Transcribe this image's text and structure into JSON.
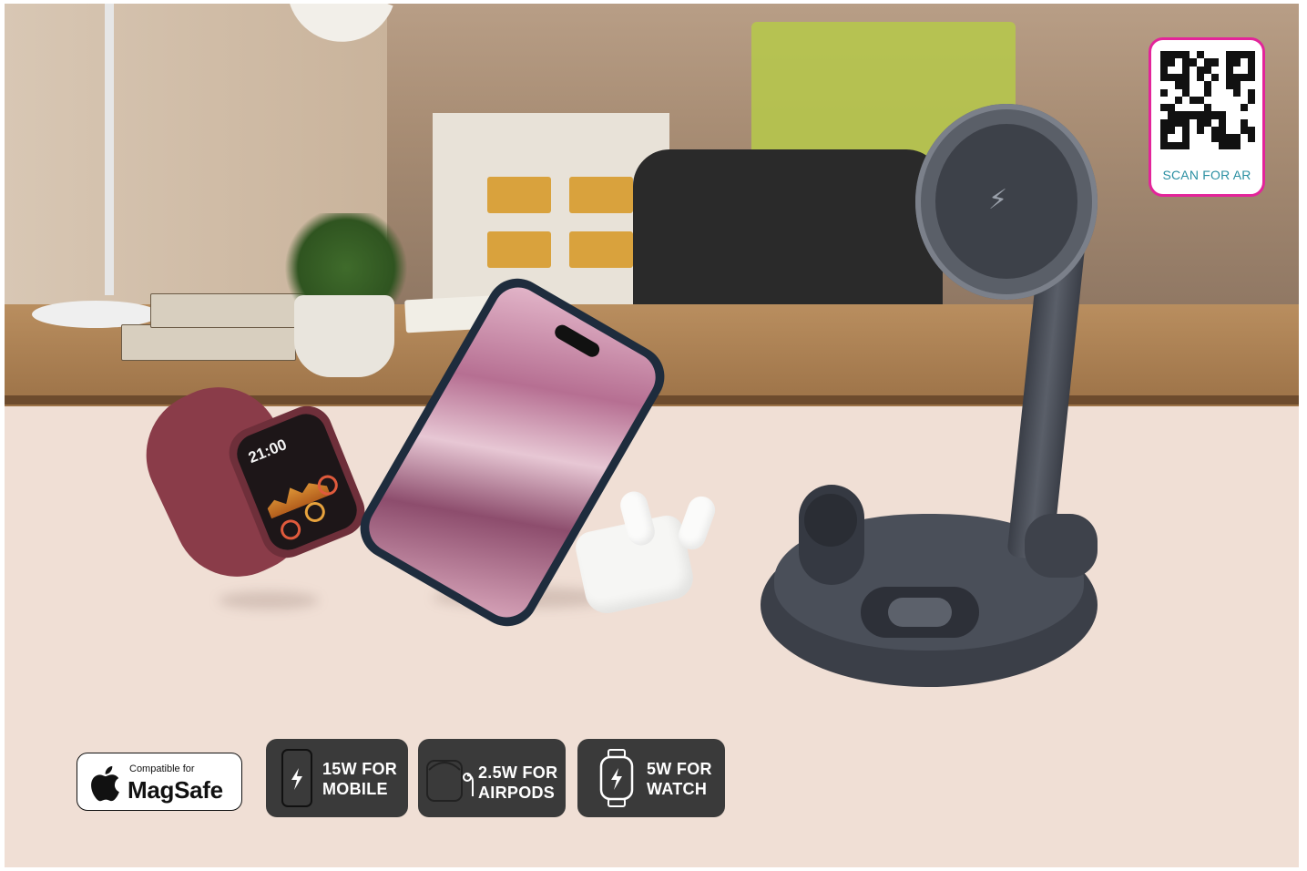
{
  "qr_badge": {
    "label": "SCAN FOR AR",
    "border_color": "#e3249a",
    "text_color": "#2a8fa2",
    "icon": "qr-code-icon"
  },
  "magsafe_badge": {
    "small_text": "Compatible for",
    "big_text": "MagSafe",
    "icon": "apple-logo-icon"
  },
  "specs": [
    {
      "line1": "15W FOR",
      "line2": "MOBILE",
      "icon": "phone-charging-icon"
    },
    {
      "line1": "2.5W FOR",
      "line2": "AIRPODS",
      "icon": "airpods-case-icon"
    },
    {
      "line1": "5W FOR",
      "line2": "WATCH",
      "icon": "watch-charging-icon"
    }
  ],
  "product_scene": {
    "watch_time": "21:00",
    "icons": [
      "smartwatch-icon",
      "smartphone-icon",
      "airpods-icon",
      "wireless-charger-icon",
      "bolt-icon"
    ]
  },
  "colors": {
    "badge_dark": "#3a3a3a",
    "background": "#f0dfd5",
    "watch": "#8a3c49",
    "charger": "#3b3f48"
  }
}
